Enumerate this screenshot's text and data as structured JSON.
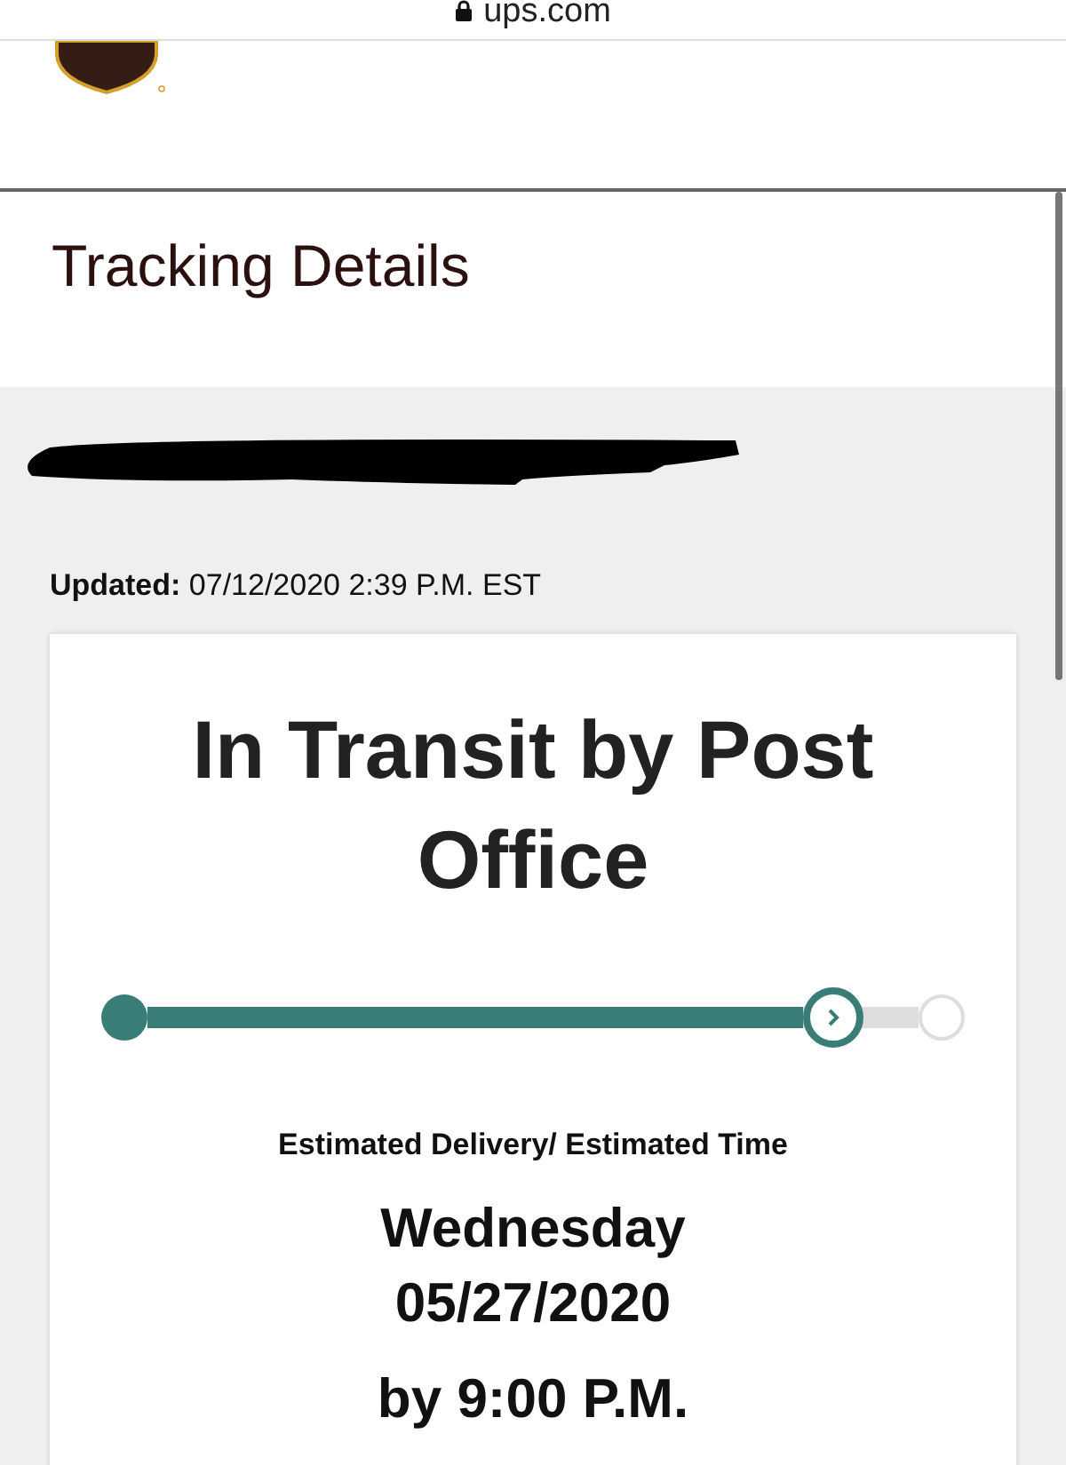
{
  "address_bar": {
    "url": "ups.com"
  },
  "page_title": "Tracking Details",
  "tracking_number": {
    "redacted": true
  },
  "updated": {
    "label": "Updated:",
    "value": "07/12/2020 2:39 P.M. EST"
  },
  "status_card": {
    "status": "In Transit by Post Office",
    "progress": {
      "level": 0.89
    },
    "estimate_label": "Estimated Delivery/ Estimated Time",
    "day": "Wednesday",
    "date": "05/27/2020",
    "time": "by 9:00 P.M."
  }
}
